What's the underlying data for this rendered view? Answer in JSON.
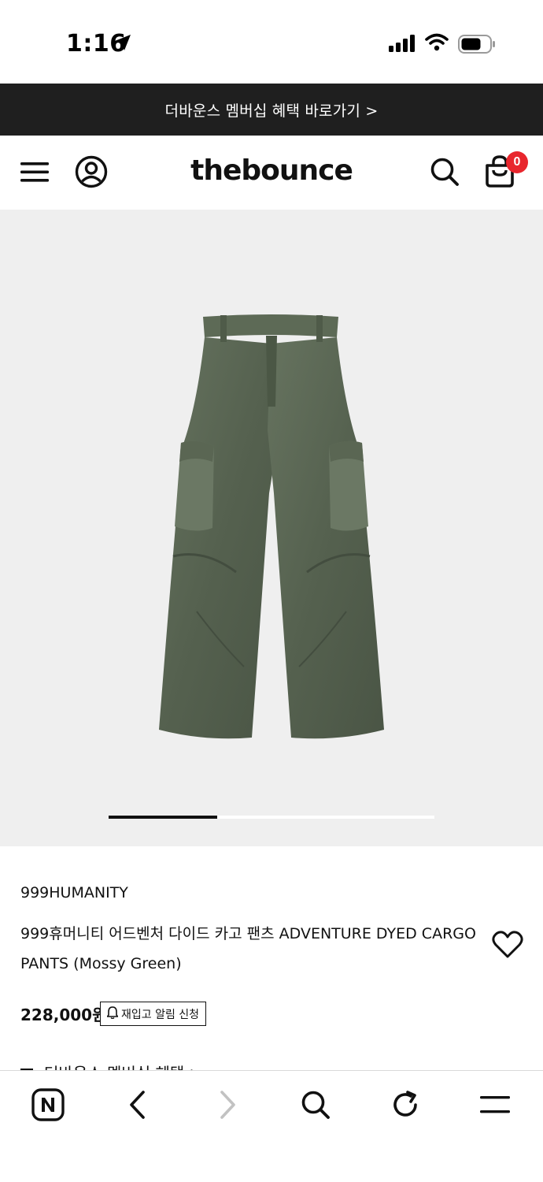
{
  "status_bar": {
    "time": "1:16",
    "icons": [
      "location-arrow-icon",
      "signal-icon",
      "wifi-icon",
      "battery-icon"
    ]
  },
  "promo_banner": {
    "text": "더바운스 멤버십 혜택 바로가기 >"
  },
  "header": {
    "logo": "thebounce",
    "cart_count": "0",
    "icons": [
      "menu-icon",
      "account-icon",
      "search-icon",
      "cart-icon"
    ]
  },
  "gallery": {
    "image_description": "olive green cargo pants",
    "slide_index": 1,
    "slide_count": 3
  },
  "product": {
    "brand": "999HUMANITY",
    "name": "999휴머니티 어드벤처 다이드 카고 팬츠 ADVENTURE DYED CARGO PANTS (Mossy Green)",
    "price": "228,000원",
    "restock_label": "재입고 알림 신청",
    "membership_text": "더바운스 멤버십 혜택  >"
  },
  "browser_toolbar": {
    "icons": [
      "naver-icon",
      "back-icon",
      "forward-icon",
      "search-icon",
      "refresh-icon",
      "menu-icon"
    ]
  },
  "colors": {
    "banner_bg": "#1f1f1f",
    "badge": "#e8262d",
    "gallery_bg": "#efefef",
    "pants": "#5c6a57"
  }
}
